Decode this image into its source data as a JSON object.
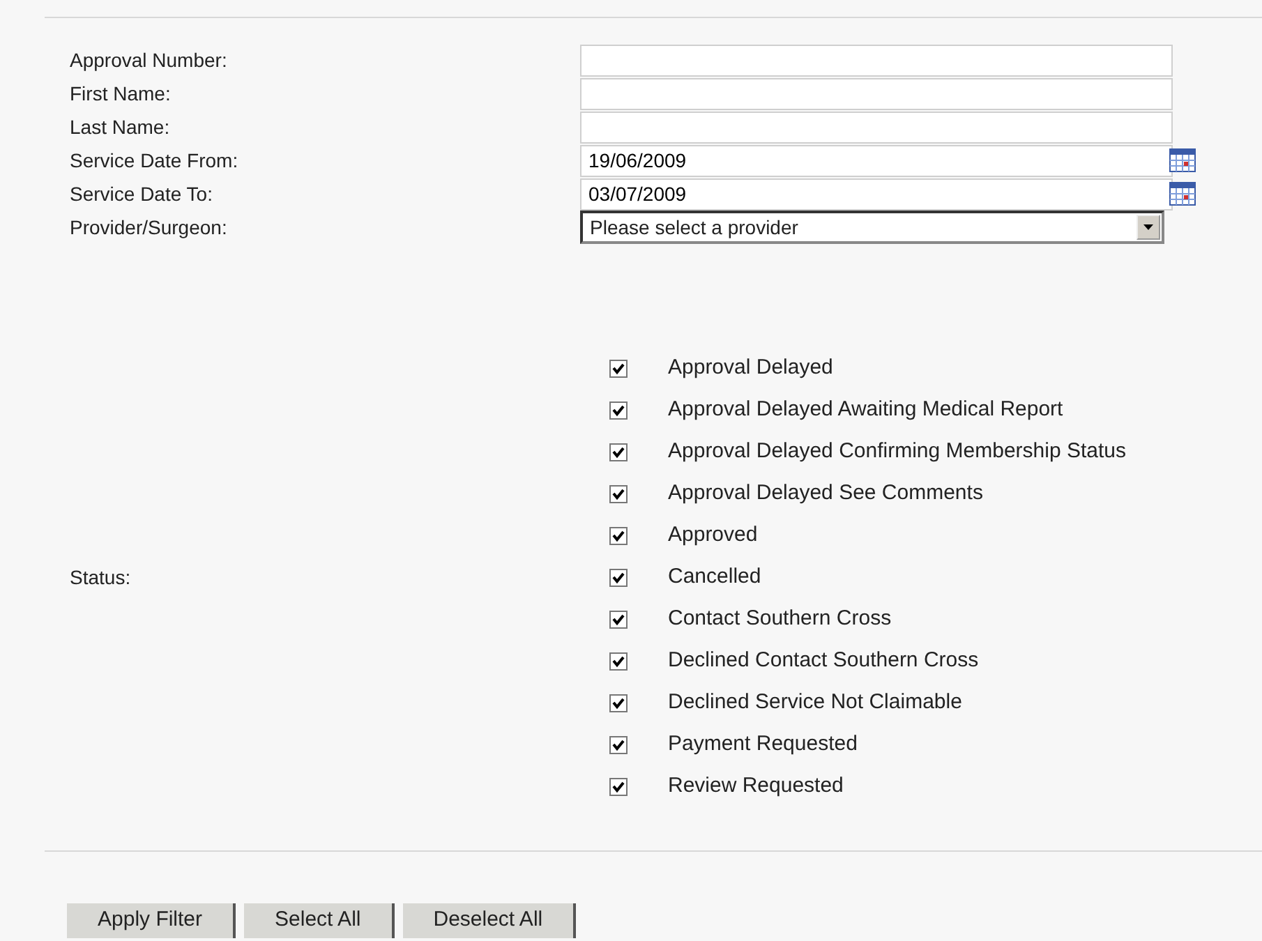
{
  "fields": [
    {
      "kind": "text",
      "label": "Approval Number:"
    },
    {
      "kind": "text",
      "label": "First Name:"
    },
    {
      "kind": "text",
      "label": "Last Name:"
    },
    {
      "kind": "date",
      "label": "Service Date From:",
      "value": "19/06/2009"
    },
    {
      "kind": "date",
      "label": "Service Date To:",
      "value": "03/07/2009"
    },
    {
      "kind": "select",
      "label": "Provider/Surgeon:",
      "value": "Please select a provider"
    }
  ],
  "status": {
    "label": "Status:",
    "options": [
      {
        "label": "Approval Delayed",
        "checked": true
      },
      {
        "label": "Approval Delayed Awaiting Medical Report",
        "checked": true
      },
      {
        "label": "Approval Delayed Confirming Membership Status",
        "checked": true
      },
      {
        "label": "Approval Delayed See Comments",
        "checked": true
      },
      {
        "label": "Approved",
        "checked": true
      },
      {
        "label": "Cancelled",
        "checked": true
      },
      {
        "label": "Contact Southern Cross",
        "checked": true
      },
      {
        "label": "Declined Contact Southern Cross",
        "checked": true
      },
      {
        "label": "Declined Service Not Claimable",
        "checked": true
      },
      {
        "label": "Payment Requested",
        "checked": true
      },
      {
        "label": "Review Requested",
        "checked": true
      }
    ]
  },
  "buttons": [
    "Apply Filter",
    "Select All",
    "Deselect All"
  ]
}
